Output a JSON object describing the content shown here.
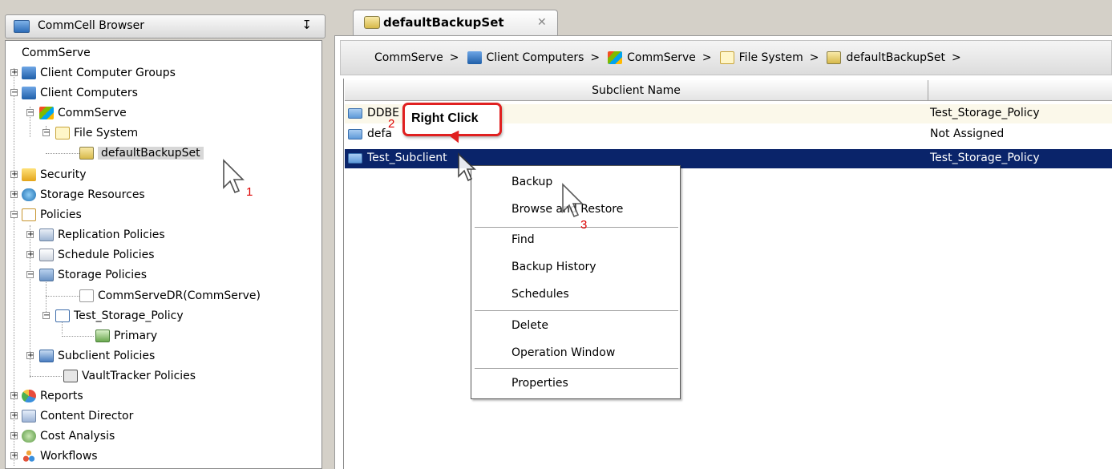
{
  "left_panel": {
    "title": "CommCell Browser",
    "pin_glyph": "を",
    "tree": [
      {
        "label": "CommServe"
      },
      {
        "label": "Client Computer Groups"
      },
      {
        "label": "Client Computers"
      },
      {
        "label": "CommServe"
      },
      {
        "label": "File System"
      },
      {
        "label": "defaultBackupSet"
      },
      {
        "label": "Security"
      },
      {
        "label": "Storage Resources"
      },
      {
        "label": "Policies"
      },
      {
        "label": "Replication Policies"
      },
      {
        "label": "Schedule Policies"
      },
      {
        "label": "Storage Policies"
      },
      {
        "label": "CommServeDR(CommServe)"
      },
      {
        "label": "Test_Storage_Policy"
      },
      {
        "label": "Primary"
      },
      {
        "label": "Subclient Policies"
      },
      {
        "label": "VaultTracker Policies"
      },
      {
        "label": "Reports"
      },
      {
        "label": "Content Director"
      },
      {
        "label": "Cost Analysis"
      },
      {
        "label": "Workflows"
      }
    ]
  },
  "tab": {
    "title": "defaultBackupSet",
    "close_glyph": "✕"
  },
  "breadcrumb": {
    "items": [
      "CommServe",
      "Client Computers",
      "CommServe",
      "File System",
      "defaultBackupSet"
    ],
    "separator": ">"
  },
  "grid": {
    "columns": [
      "Subclient Name",
      ""
    ],
    "rows": [
      {
        "name": "DDBE",
        "policy": "Test_Storage_Policy"
      },
      {
        "name": "defa",
        "policy": "Not Assigned"
      },
      {
        "name": "Test_Subclient",
        "policy": "Test_Storage_Policy"
      }
    ]
  },
  "context_menu": {
    "items": [
      "Backup",
      "Browse and Restore",
      "Find",
      "Backup History",
      "Schedules",
      "Delete",
      "Operation Window",
      "Properties"
    ]
  },
  "annotations": {
    "callout": "Right Click",
    "step1": "1",
    "step2": "2",
    "step3": "3"
  },
  "colors": {
    "selection": "#0a246a",
    "callout_border": "#e02020",
    "step_number": "#dd0000"
  }
}
